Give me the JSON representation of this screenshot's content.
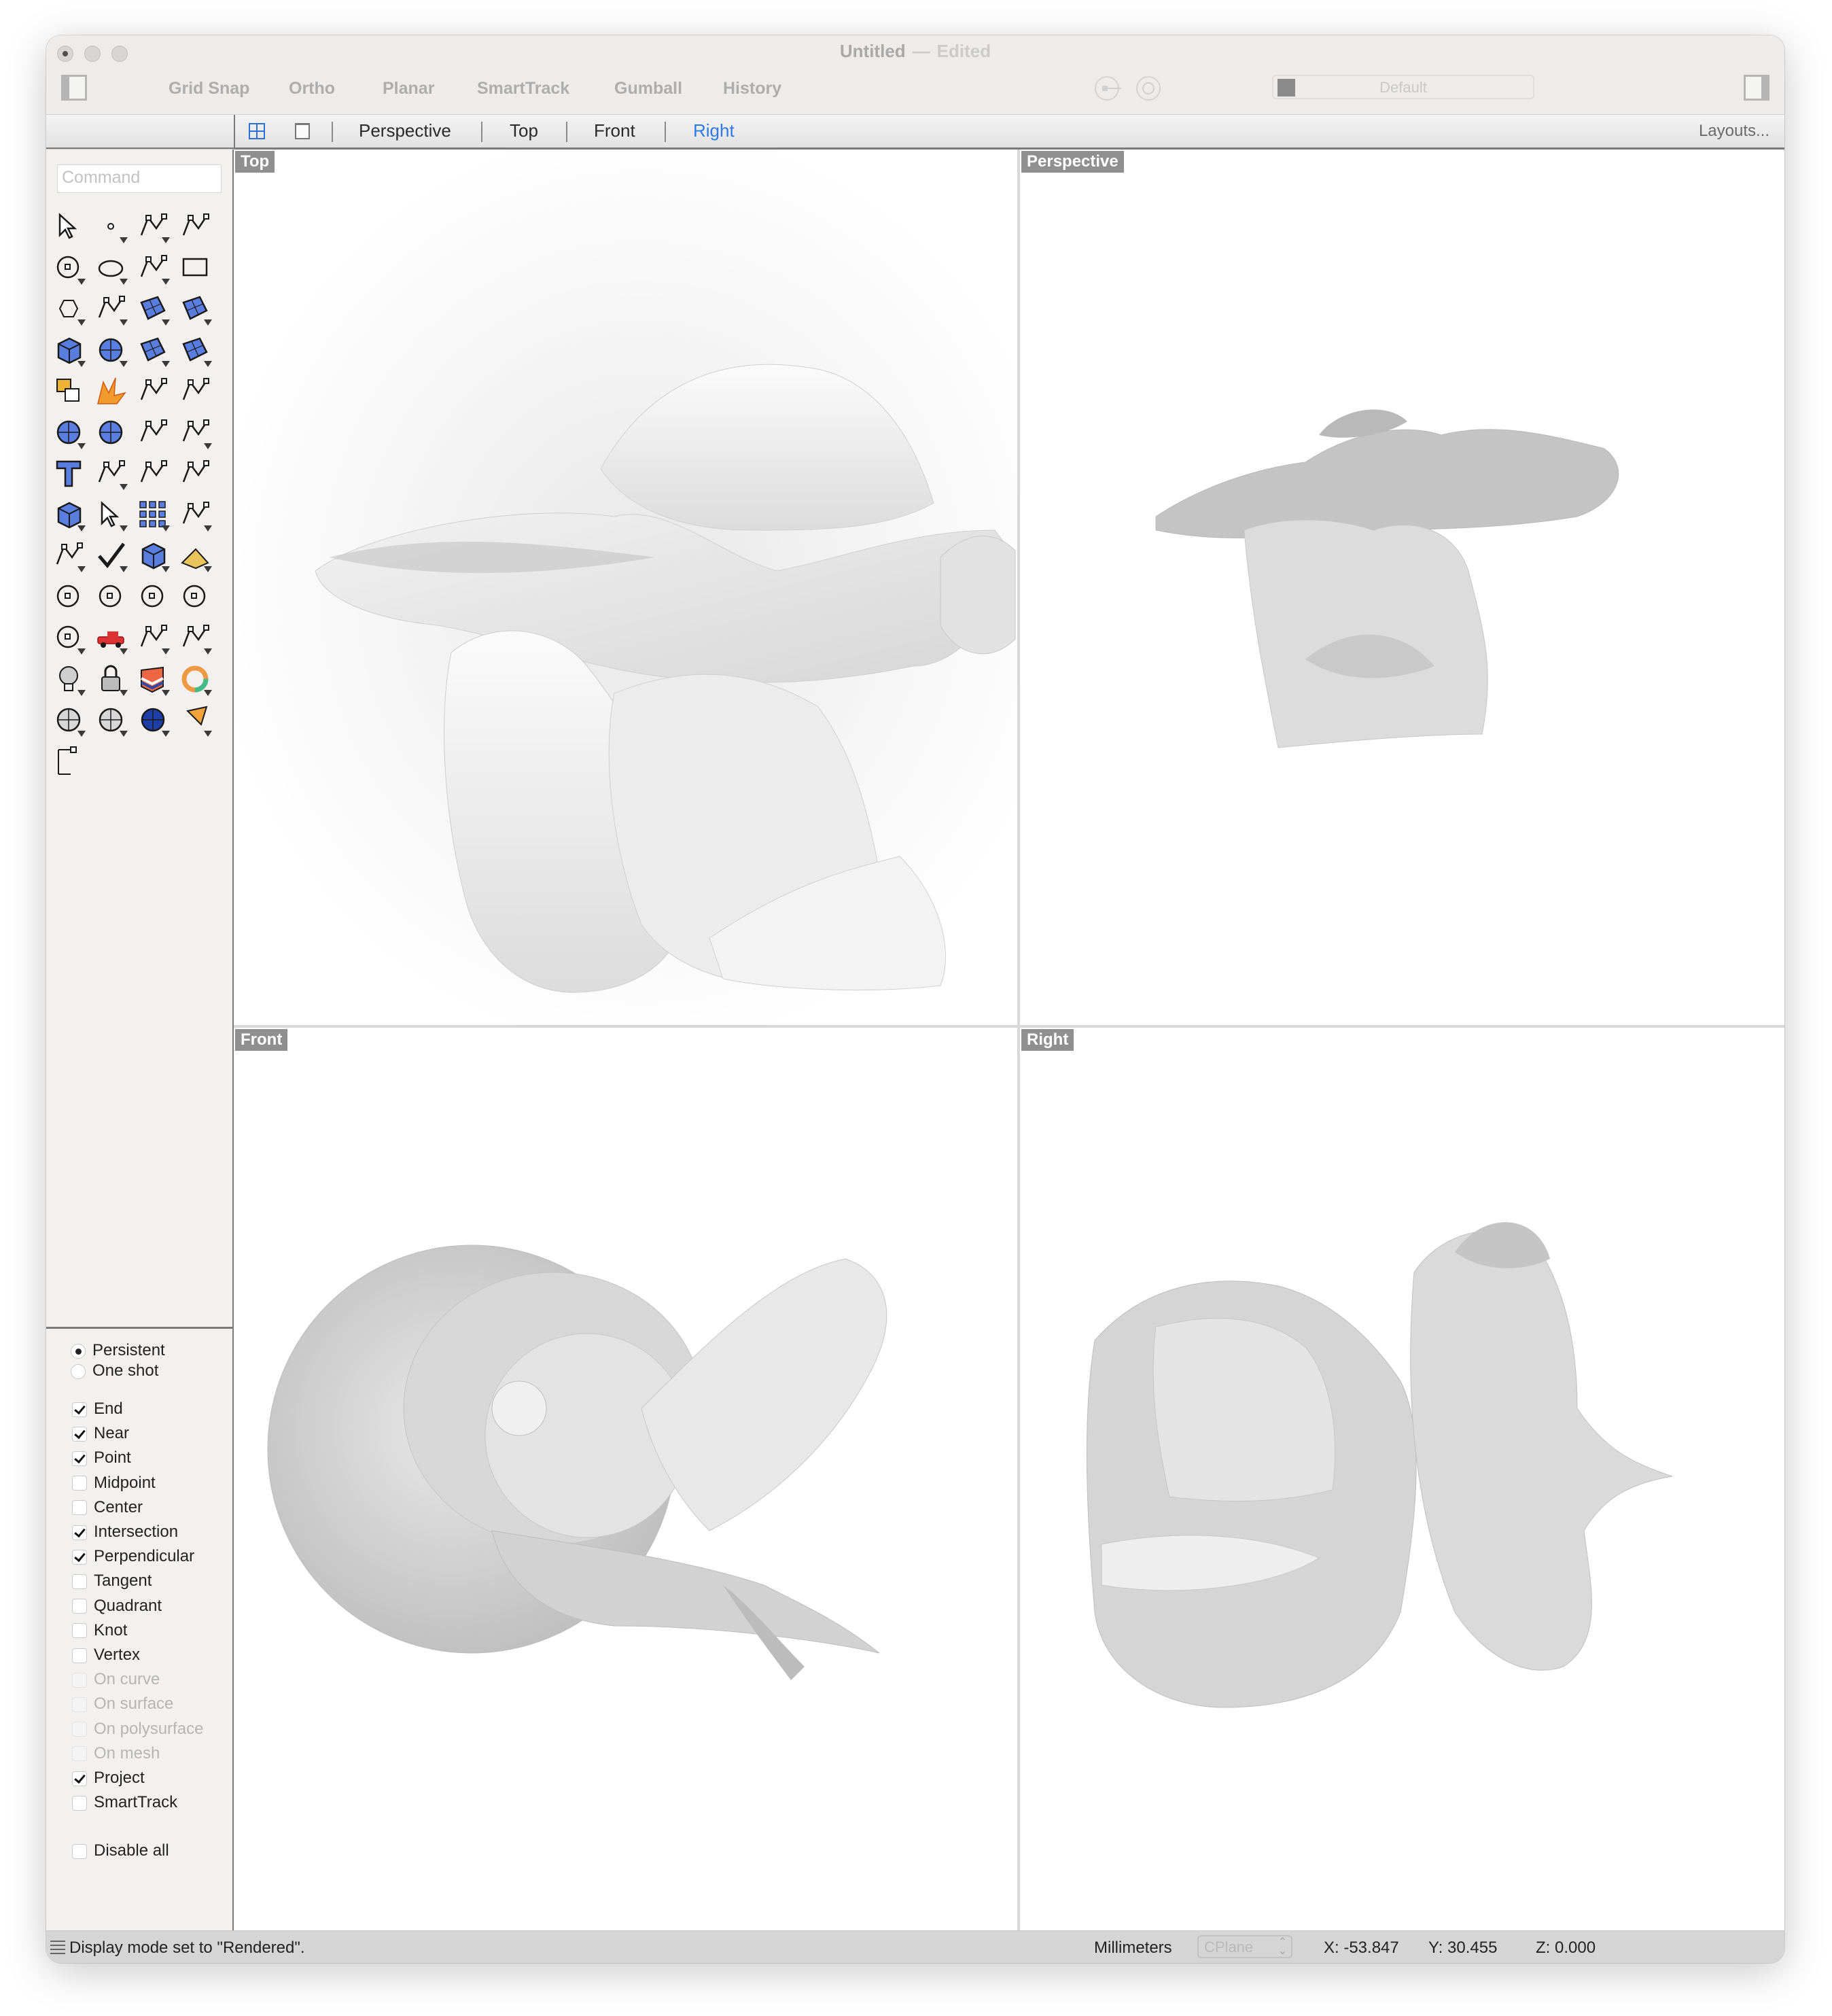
{
  "window": {
    "title": "Untitled",
    "title_status": "Edited",
    "title_separator": "—"
  },
  "toolbar": {
    "toggles": [
      "Grid Snap",
      "Ortho",
      "Planar",
      "SmartTrack",
      "Gumball",
      "History"
    ],
    "current_layer": "Default",
    "layer_color": "#8b8b8b"
  },
  "tabbar": {
    "tabs": [
      {
        "label": "Perspective",
        "active": false
      },
      {
        "label": "Top",
        "active": false
      },
      {
        "label": "Front",
        "active": false
      },
      {
        "label": "Right",
        "active": true
      }
    ],
    "layouts_label": "Layouts...",
    "accent_color": "#2f78e6"
  },
  "sidebar": {
    "command_placeholder": "Command",
    "tools": [
      "select-arrow-icon",
      "point-icon",
      "polyline-icon",
      "curve-icon",
      "circle-icon",
      "ellipse-icon",
      "arc-icon",
      "rectangle-icon",
      "polygon-icon",
      "fillet-curve-icon",
      "surface-corners-icon",
      "surface-extrude-icon",
      "box-solid-icon",
      "sphere-union-icon",
      "cylinder-tube-icon",
      "mesh-surface-icon",
      "join-puzzle-icon",
      "explode-icon",
      "trim-icon",
      "split-icon",
      "boolean-union-icon",
      "group-icon",
      "rebuild-curve-icon",
      "offset-curve-icon",
      "text-icon",
      "move-icon",
      "copy-icon",
      "rotate-icon",
      "solid-cap-icon",
      "extrude-arrows-icon",
      "array-icon",
      "mirror-icon",
      "solid-tools-icon",
      "check-icon",
      "primitives-icon",
      "analyze-pyramid-icon",
      "zoom-in-out-icon",
      "zoom-window-icon",
      "zoom-extents-icon",
      "zoom-selected-icon",
      "rotate-view-icon",
      "car-walkabout-icon",
      "cplane-grid-icon",
      "select-shapes-icon",
      "light-bulb-icon",
      "lock-icon",
      "layer-stack-icon",
      "color-wheel-icon",
      "shaded-sphere-icon",
      "grid-sphere-icon",
      "rendered-sphere-icon",
      "spotlight-cone-icon",
      "dimension-icon"
    ],
    "osnap": {
      "modes": [
        {
          "label": "Persistent",
          "selected": true
        },
        {
          "label": "One shot",
          "selected": false
        }
      ],
      "snaps": [
        {
          "label": "End",
          "checked": true,
          "enabled": true
        },
        {
          "label": "Near",
          "checked": true,
          "enabled": true
        },
        {
          "label": "Point",
          "checked": true,
          "enabled": true
        },
        {
          "label": "Midpoint",
          "checked": false,
          "enabled": true
        },
        {
          "label": "Center",
          "checked": false,
          "enabled": true
        },
        {
          "label": "Intersection",
          "checked": true,
          "enabled": true
        },
        {
          "label": "Perpendicular",
          "checked": true,
          "enabled": true
        },
        {
          "label": "Tangent",
          "checked": false,
          "enabled": true
        },
        {
          "label": "Quadrant",
          "checked": false,
          "enabled": true
        },
        {
          "label": "Knot",
          "checked": false,
          "enabled": true
        },
        {
          "label": "Vertex",
          "checked": false,
          "enabled": true
        },
        {
          "label": "On curve",
          "checked": false,
          "enabled": false
        },
        {
          "label": "On surface",
          "checked": false,
          "enabled": false
        },
        {
          "label": "On polysurface",
          "checked": false,
          "enabled": false
        },
        {
          "label": "On mesh",
          "checked": false,
          "enabled": false
        },
        {
          "label": "Project",
          "checked": true,
          "enabled": true
        },
        {
          "label": "SmartTrack",
          "checked": false,
          "enabled": true
        }
      ],
      "disable_all": {
        "label": "Disable all",
        "checked": false
      }
    }
  },
  "viewports": [
    {
      "label": "Top"
    },
    {
      "label": "Perspective"
    },
    {
      "label": "Front"
    },
    {
      "label": "Right"
    }
  ],
  "statusbar": {
    "message": "Display mode set to \"Rendered\".",
    "units": "Millimeters",
    "cplane": "CPlane",
    "x": "X: -53.847",
    "y": "Y: 30.455",
    "z": "Z: 0.000"
  }
}
